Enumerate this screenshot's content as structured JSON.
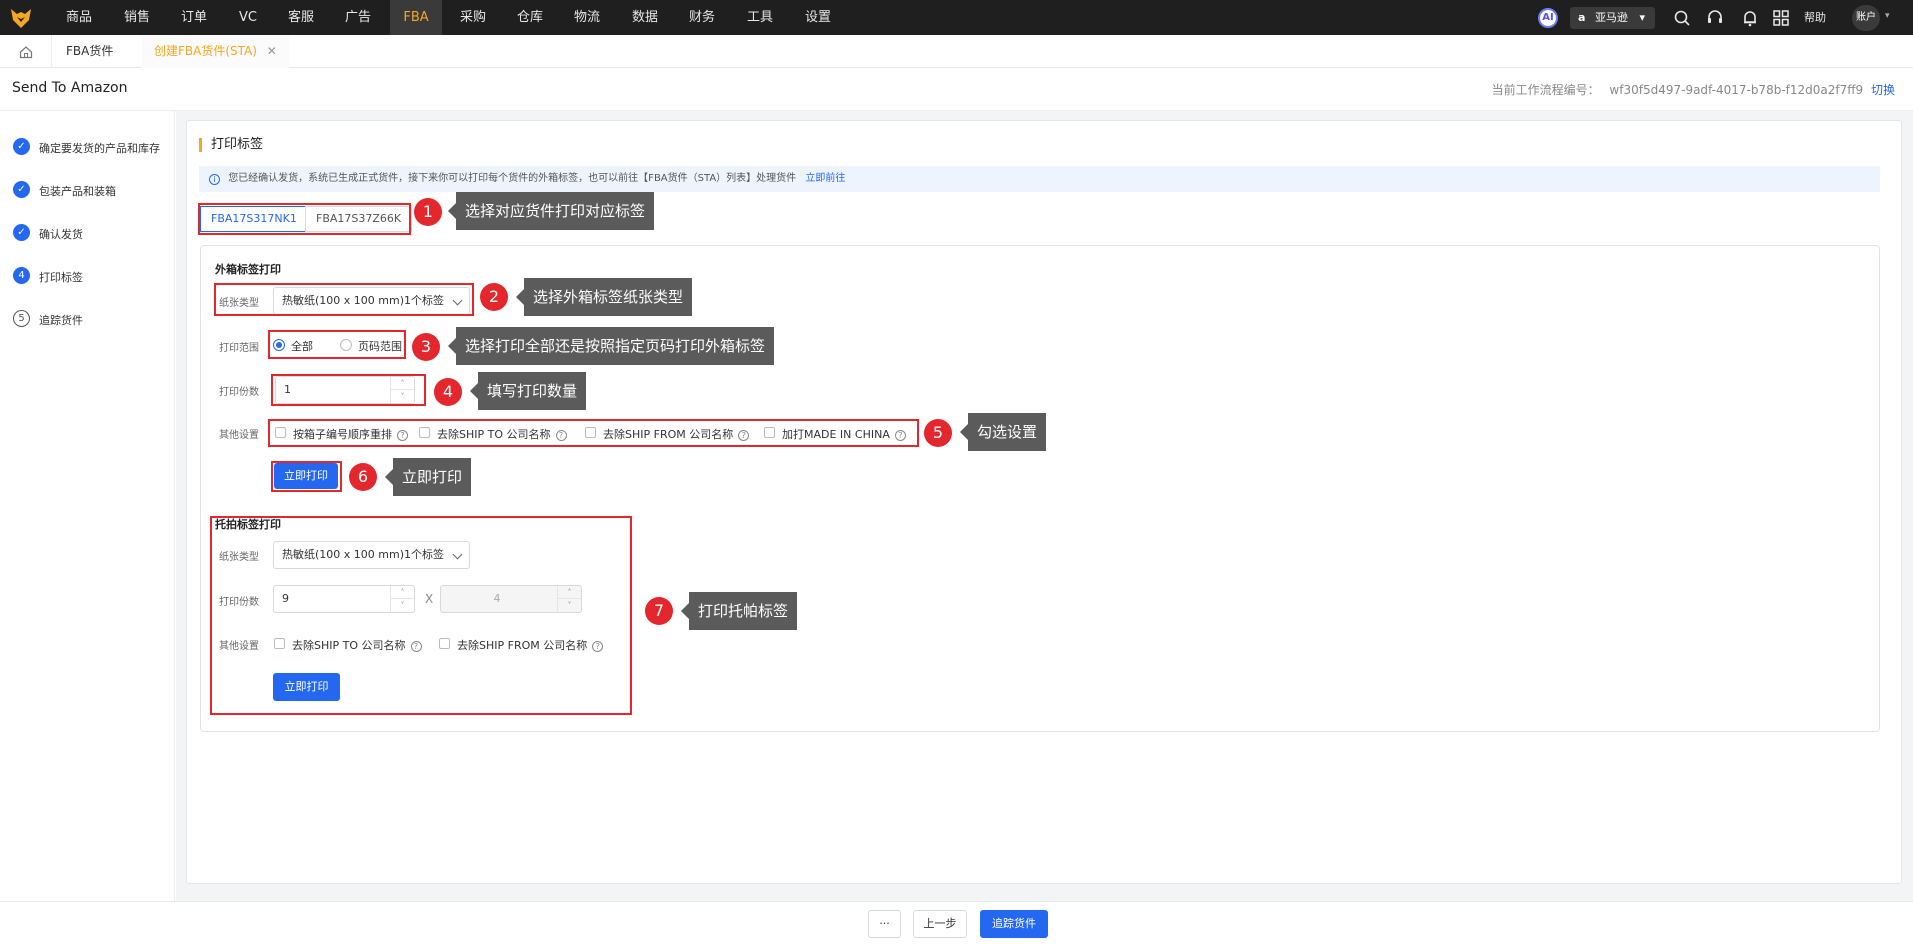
{
  "nav": {
    "items": [
      {
        "label": "商品"
      },
      {
        "label": "销售"
      },
      {
        "label": "订单"
      },
      {
        "label": "VC"
      },
      {
        "label": "客服"
      },
      {
        "label": "广告"
      },
      {
        "label": "FBA"
      },
      {
        "label": "采购"
      },
      {
        "label": "仓库"
      },
      {
        "label": "物流"
      },
      {
        "label": "数据"
      },
      {
        "label": "财务"
      },
      {
        "label": "工具"
      },
      {
        "label": "设置"
      }
    ],
    "active": "FBA",
    "ai_label": "AI",
    "store_label": "亚马逊",
    "help_label": "帮助",
    "account_label": "账户"
  },
  "tabs": {
    "items": [
      {
        "label": "FBA货件"
      },
      {
        "label": "创建FBA货件(STA)",
        "close": "✕"
      }
    ]
  },
  "header": {
    "title": "Send To Amazon",
    "flow_label": "当前工作流程编号：",
    "flow_id": "wf30f5d497-9adf-4017-b78b-f12d0a2f7ff9",
    "switch_label": "切换"
  },
  "steps": [
    {
      "index": "✓",
      "label": "确定要发货的产品和库存"
    },
    {
      "index": "✓",
      "label": "包装产品和装箱"
    },
    {
      "index": "✓",
      "label": "确认发货"
    },
    {
      "index": "4",
      "label": "打印标签"
    },
    {
      "index": "5",
      "label": "追踪货件"
    }
  ],
  "main": {
    "section_title": "打印标签",
    "info_text": "您已经确认发货，系统已生成正式货件，接下来你可以打印每个货件的外箱标签，也可以前往【FBA货件（STA）列表】处理货件",
    "info_link": "立即前往",
    "info_icon": "i",
    "shipments": [
      "FBA17S317NK1",
      "FBA17S37Z66K"
    ],
    "carton": {
      "title": "外箱标签打印",
      "paper_label": "纸张类型",
      "paper_value": "热敏纸(100 x 100 mm)1个标签",
      "range_label": "打印范围",
      "range_options": [
        "全部",
        "页码范围"
      ],
      "range_selected": "全部",
      "copies_label": "打印份数",
      "copies_value": "1",
      "other_label": "其他设置",
      "options": [
        {
          "label": "按箱子编号顺序重排",
          "help": "?"
        },
        {
          "label": "去除SHIP TO 公司名称",
          "help": "?"
        },
        {
          "label": "去除SHIP FROM 公司名称",
          "help": "?"
        },
        {
          "label": "加打MADE IN CHINA",
          "help": "?"
        }
      ],
      "print_button": "立即打印"
    },
    "pallet": {
      "title": "托拍标签打印",
      "paper_label": "纸张类型",
      "paper_value": "热敏纸(100 x 100 mm)1个标签",
      "copies_label": "打印份数",
      "copies_value": "9",
      "times": "X",
      "copies_value_2": "4",
      "other_label": "其他设置",
      "options": [
        {
          "label": "去除SHIP TO 公司名称",
          "help": "?"
        },
        {
          "label": "去除SHIP FROM 公司名称",
          "help": "?"
        }
      ],
      "print_button": "立即打印"
    }
  },
  "annotations": [
    {
      "num": "1",
      "text": "选择对应货件打印对应标签"
    },
    {
      "num": "2",
      "text": "选择外箱标签纸张类型"
    },
    {
      "num": "3",
      "text": "选择打印全部还是按照指定页码打印外箱标签"
    },
    {
      "num": "4",
      "text": "填写打印数量"
    },
    {
      "num": "5",
      "text": "勾选设置"
    },
    {
      "num": "6",
      "text": "立即打印"
    },
    {
      "num": "7",
      "text": "打印托帕标签"
    }
  ],
  "spinner": {
    "up": "˄",
    "down": "˅"
  },
  "footer": {
    "more_label": "···",
    "prev_label": "上一步",
    "next_label": "追踪货件"
  },
  "colors": {
    "primary": "#2468f2",
    "accent": "#f5a623",
    "annotation": "#e4262d",
    "topbar": "#1f1f1f"
  }
}
